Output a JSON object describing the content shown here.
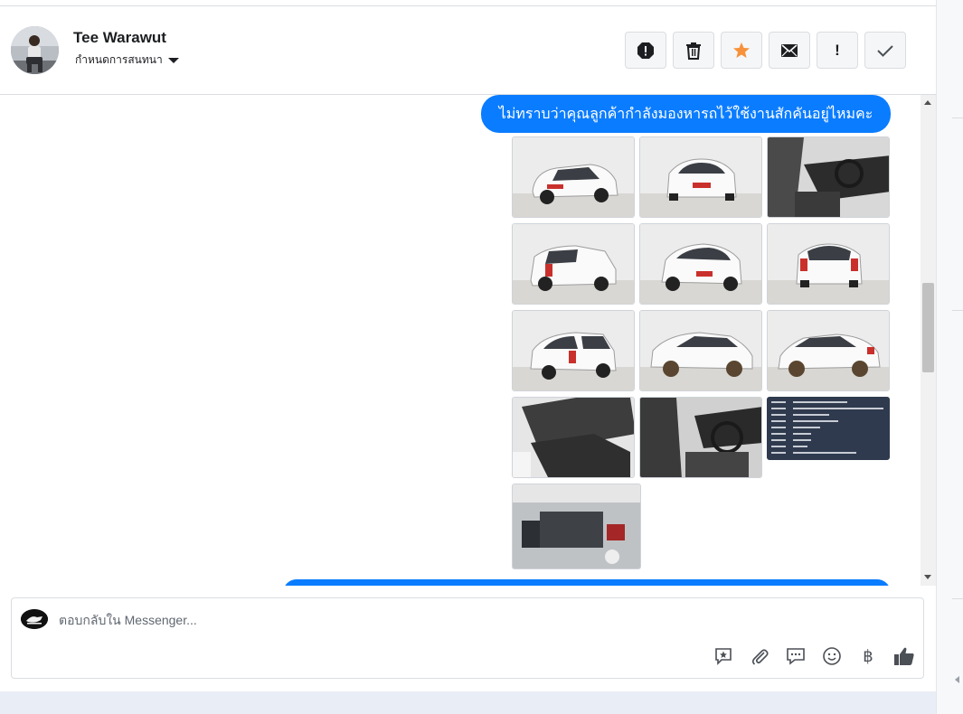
{
  "header": {
    "contact_name": "Tee Warawut",
    "conversation_settings_label": "กำหนดการสนทนา",
    "toolbar_buttons": [
      {
        "icon": "spam-icon",
        "color": "#1c1e21"
      },
      {
        "icon": "trash-icon",
        "color": "#1c1e21"
      },
      {
        "icon": "star-icon",
        "color": "#f7923b"
      },
      {
        "icon": "mail-icon",
        "color": "#1c1e21"
      },
      {
        "icon": "important-icon",
        "label": "!",
        "color": "#1c1e21"
      },
      {
        "icon": "check-icon",
        "color": "#1c1e21"
      }
    ]
  },
  "messages": {
    "outgoing_text": "ไม่ทราบว่าคุณลูกค้ากำลังมองหารถไว้ใช้งานสักคันอยู่ไหมคะ",
    "bubble_color": "#0a7cff",
    "photos": [
      "car-front-left-photo",
      "car-front-photo",
      "car-interior-dashboard-photo",
      "car-rear-left-photo",
      "car-front-angle-photo",
      "car-rear-photo",
      "car-rear-three-quarter-photo",
      "car-side-right-photo",
      "car-side-left-photo",
      "car-rear-seats-photo",
      "car-driver-seat-photo",
      "car-spec-sheet-photo",
      "car-engine-bay-photo"
    ]
  },
  "composer": {
    "placeholder": "ตอบกลับใน Messenger...",
    "tools": [
      "saved-reply-icon",
      "attachment-icon",
      "quick-reply-icon",
      "emoji-icon",
      "baht-icon",
      "thumbs-up-icon"
    ],
    "currency_symbol": "฿"
  }
}
